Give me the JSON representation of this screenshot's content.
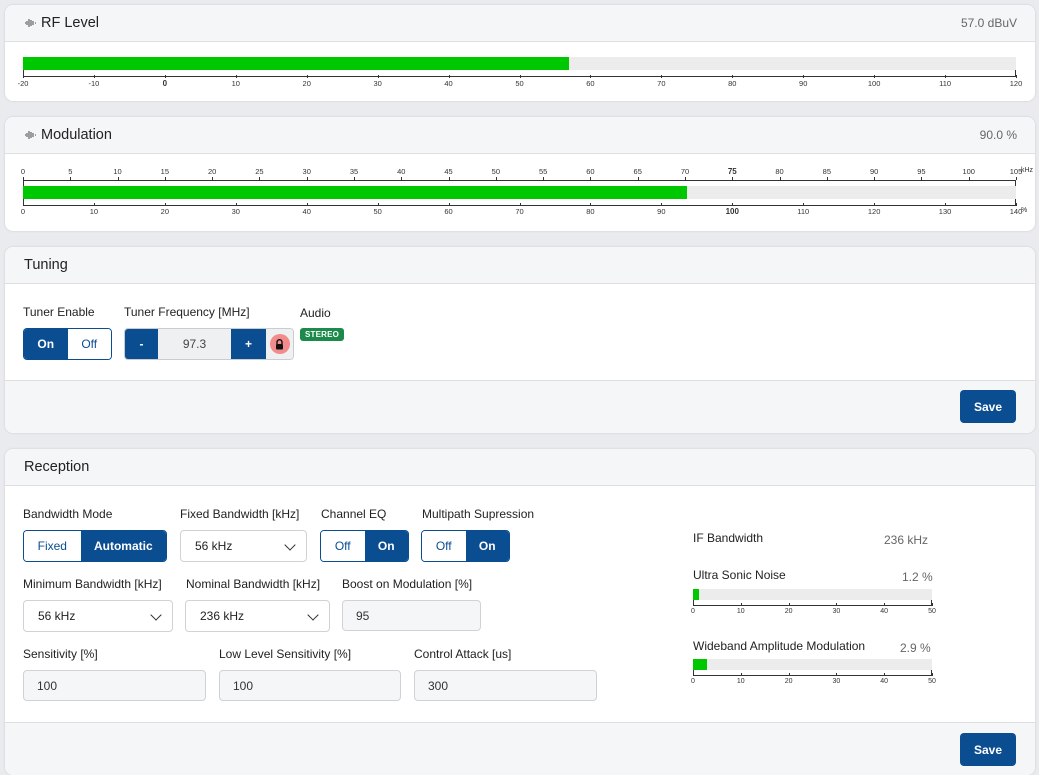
{
  "rf_level": {
    "title": "RF Level",
    "value": "57.0 dBuV",
    "scale": {
      "min": -20,
      "max": 120,
      "current": 57.0,
      "ticks": [
        "-20",
        "-10",
        "0",
        "10",
        "20",
        "30",
        "40",
        "50",
        "60",
        "70",
        "80",
        "90",
        "100",
        "110",
        "120"
      ]
    }
  },
  "modulation": {
    "title": "Modulation",
    "value": "90.0 %",
    "top_scale": {
      "min": 0,
      "max": 105,
      "unit": "kHz",
      "ticks": [
        "0",
        "5",
        "10",
        "15",
        "20",
        "25",
        "30",
        "35",
        "40",
        "45",
        "50",
        "55",
        "60",
        "65",
        "70",
        "75",
        "80",
        "85",
        "90",
        "95",
        "100",
        "105"
      ]
    },
    "bottom_scale": {
      "min": 0,
      "max": 140,
      "unit": "%",
      "current": 93.6,
      "ticks": [
        "0",
        "10",
        "20",
        "30",
        "40",
        "50",
        "60",
        "70",
        "80",
        "90",
        "100",
        "110",
        "120",
        "130",
        "140"
      ]
    }
  },
  "tuning": {
    "title": "Tuning",
    "tuner_enable_label": "Tuner Enable",
    "tuner_enable_on": "On",
    "tuner_enable_off": "Off",
    "tuner_frequency_label": "Tuner Frequency [MHz]",
    "freq_minus": "-",
    "freq_value": "97.3",
    "freq_plus": "+",
    "audio_label": "Audio",
    "audio_badge": "STEREO",
    "save": "Save"
  },
  "reception": {
    "title": "Reception",
    "bandwidth_mode_label": "Bandwidth Mode",
    "bandwidth_mode_fixed": "Fixed",
    "bandwidth_mode_auto": "Automatic",
    "fixed_bandwidth_label": "Fixed Bandwidth [kHz]",
    "fixed_bandwidth_value": "56 kHz",
    "channel_eq_label": "Channel EQ",
    "channel_eq_off": "Off",
    "channel_eq_on": "On",
    "multipath_label": "Multipath Supression",
    "multipath_off": "Off",
    "multipath_on": "On",
    "min_bandwidth_label": "Minimum Bandwidth [kHz]",
    "min_bandwidth_value": "56 kHz",
    "nominal_bandwidth_label": "Nominal Bandwidth [kHz]",
    "nominal_bandwidth_value": "236 kHz",
    "boost_label": "Boost on Modulation [%]",
    "boost_value": "95",
    "sensitivity_label": "Sensitivity [%]",
    "sensitivity_value": "100",
    "low_level_label": "Low Level Sensitivity [%]",
    "low_level_value": "100",
    "control_attack_label": "Control Attack [us]",
    "control_attack_value": "300",
    "if_bandwidth_label": "IF Bandwidth",
    "if_bandwidth_value": "236 kHz",
    "usn_label": "Ultra Sonic Noise",
    "usn_value": "1.2 %",
    "usn_current": 1.2,
    "wam_label": "Wideband Amplitude Modulation",
    "wam_value": "2.9 %",
    "wam_current": 2.9,
    "mini_ticks": [
      "0",
      "10",
      "20",
      "30",
      "40",
      "50"
    ],
    "save": "Save"
  },
  "colors": {
    "accent": "#0b4d91",
    "meter_fill": "#00c800",
    "badge": "#1c8a4b"
  }
}
